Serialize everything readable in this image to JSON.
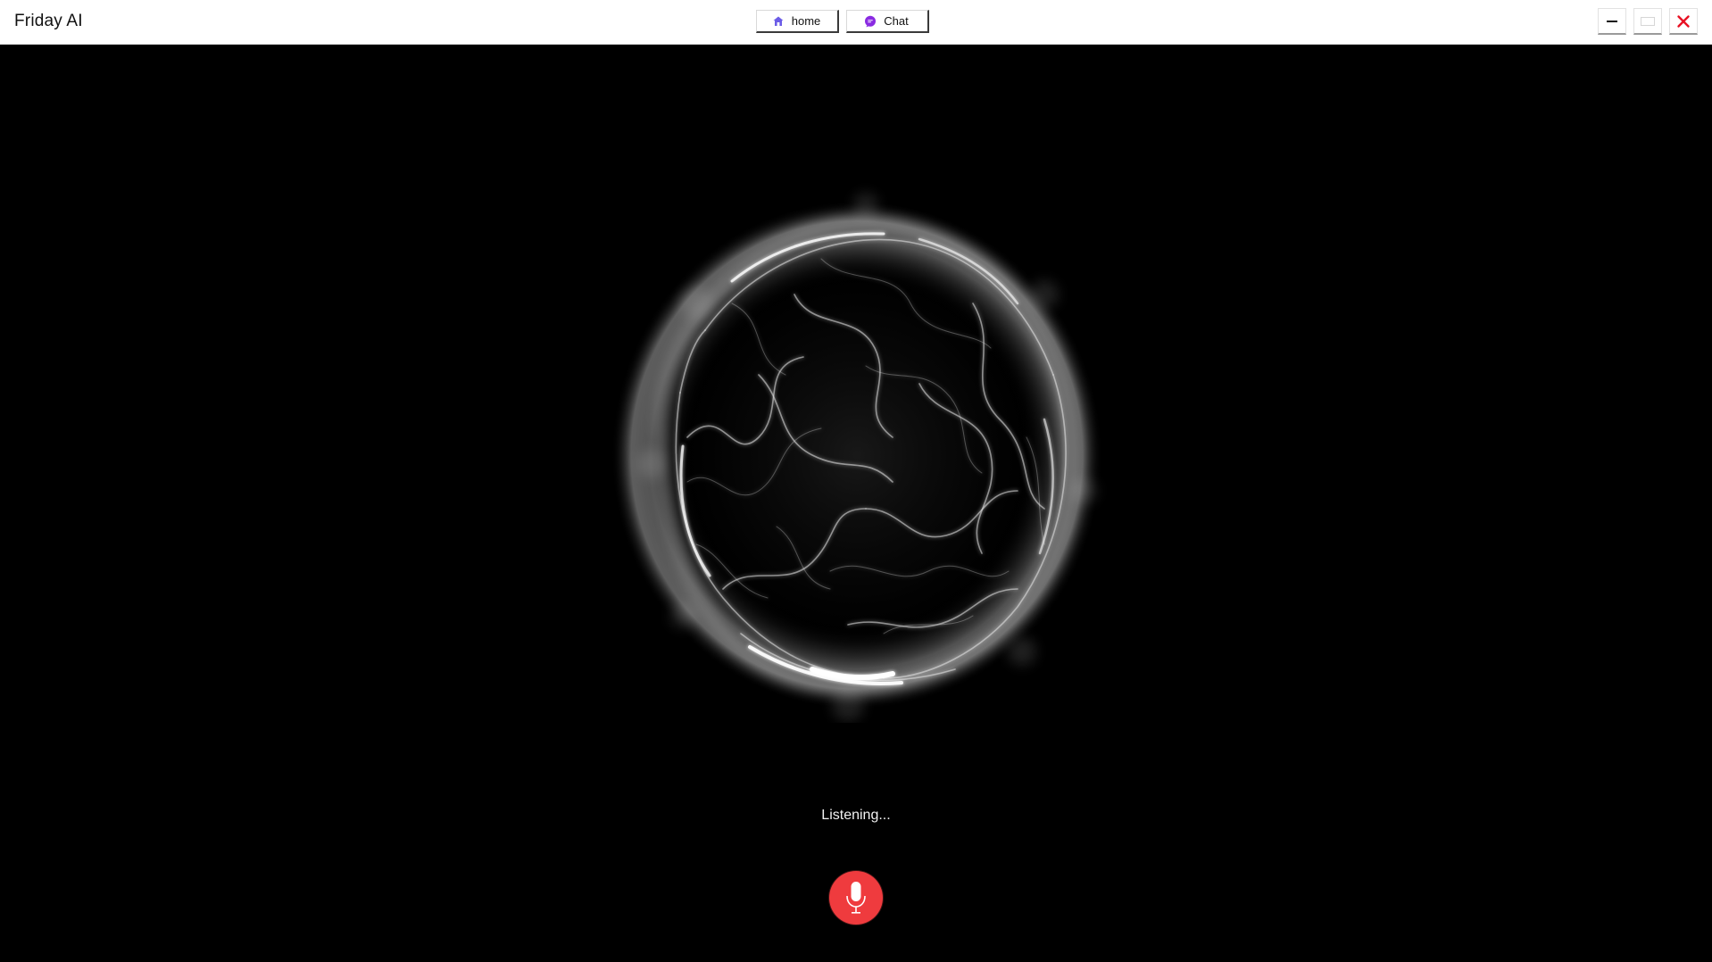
{
  "window": {
    "title": "Friday AI"
  },
  "nav": {
    "home_label": "home",
    "chat_label": "Chat"
  },
  "status": {
    "text": "Listening..."
  },
  "colors": {
    "mic_button": "#ef3b3e",
    "home_icon": "#6b5ce7",
    "chat_icon": "#8a2be2",
    "close_icon": "#e81123",
    "background": "#000000"
  },
  "icons": {
    "home": "home-icon",
    "chat": "chat-icon",
    "minimize": "minimize-icon",
    "maximize": "maximize-icon",
    "close": "close-icon",
    "microphone": "microphone-icon"
  }
}
